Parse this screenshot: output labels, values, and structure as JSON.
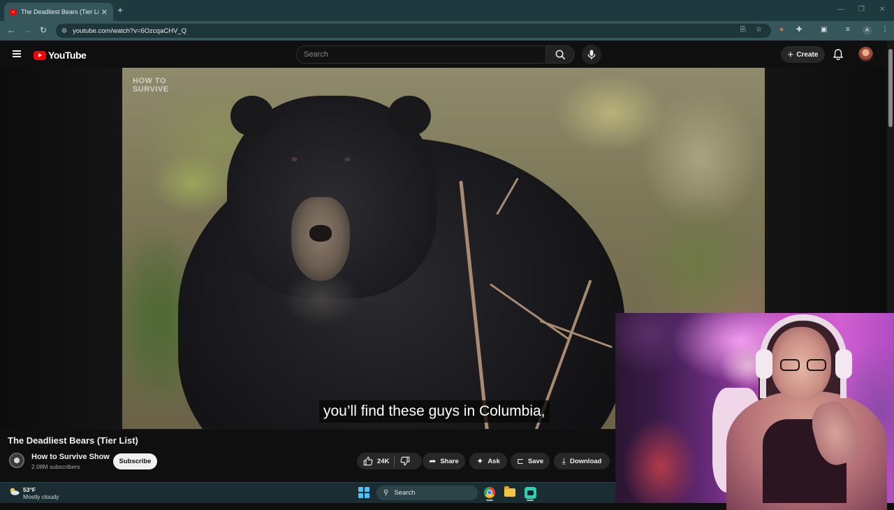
{
  "browser": {
    "tab_title": "The Deadliest Bears (Tier List) -",
    "url": "youtube.com/watch?v=6OzcqaCHV_Q",
    "profile_letter": "A"
  },
  "youtube": {
    "logo_text": "YouTube",
    "search_placeholder": "Search",
    "create_label": "Create"
  },
  "video": {
    "watermark_line1": "HOW TO",
    "watermark_line2": "SURVIVE",
    "caption": "you’ll find these guys in Columbia,",
    "title": "The Deadliest Bears (Tier List)"
  },
  "channel": {
    "name": "How to Survive Show",
    "subscribers": "2.08M subscribers",
    "subscribe_label": "Subscribe"
  },
  "actions": {
    "like_count": "24K",
    "share": "Share",
    "ask": "Ask",
    "save": "Save",
    "download": "Download"
  },
  "taskbar": {
    "temperature": "53°F",
    "weather": "Mostly cloudy",
    "search_label": "Search"
  },
  "colors": {
    "youtube_red": "#ff0000",
    "page_bg": "#0f0f0f",
    "browser_chrome": "#35575c"
  }
}
